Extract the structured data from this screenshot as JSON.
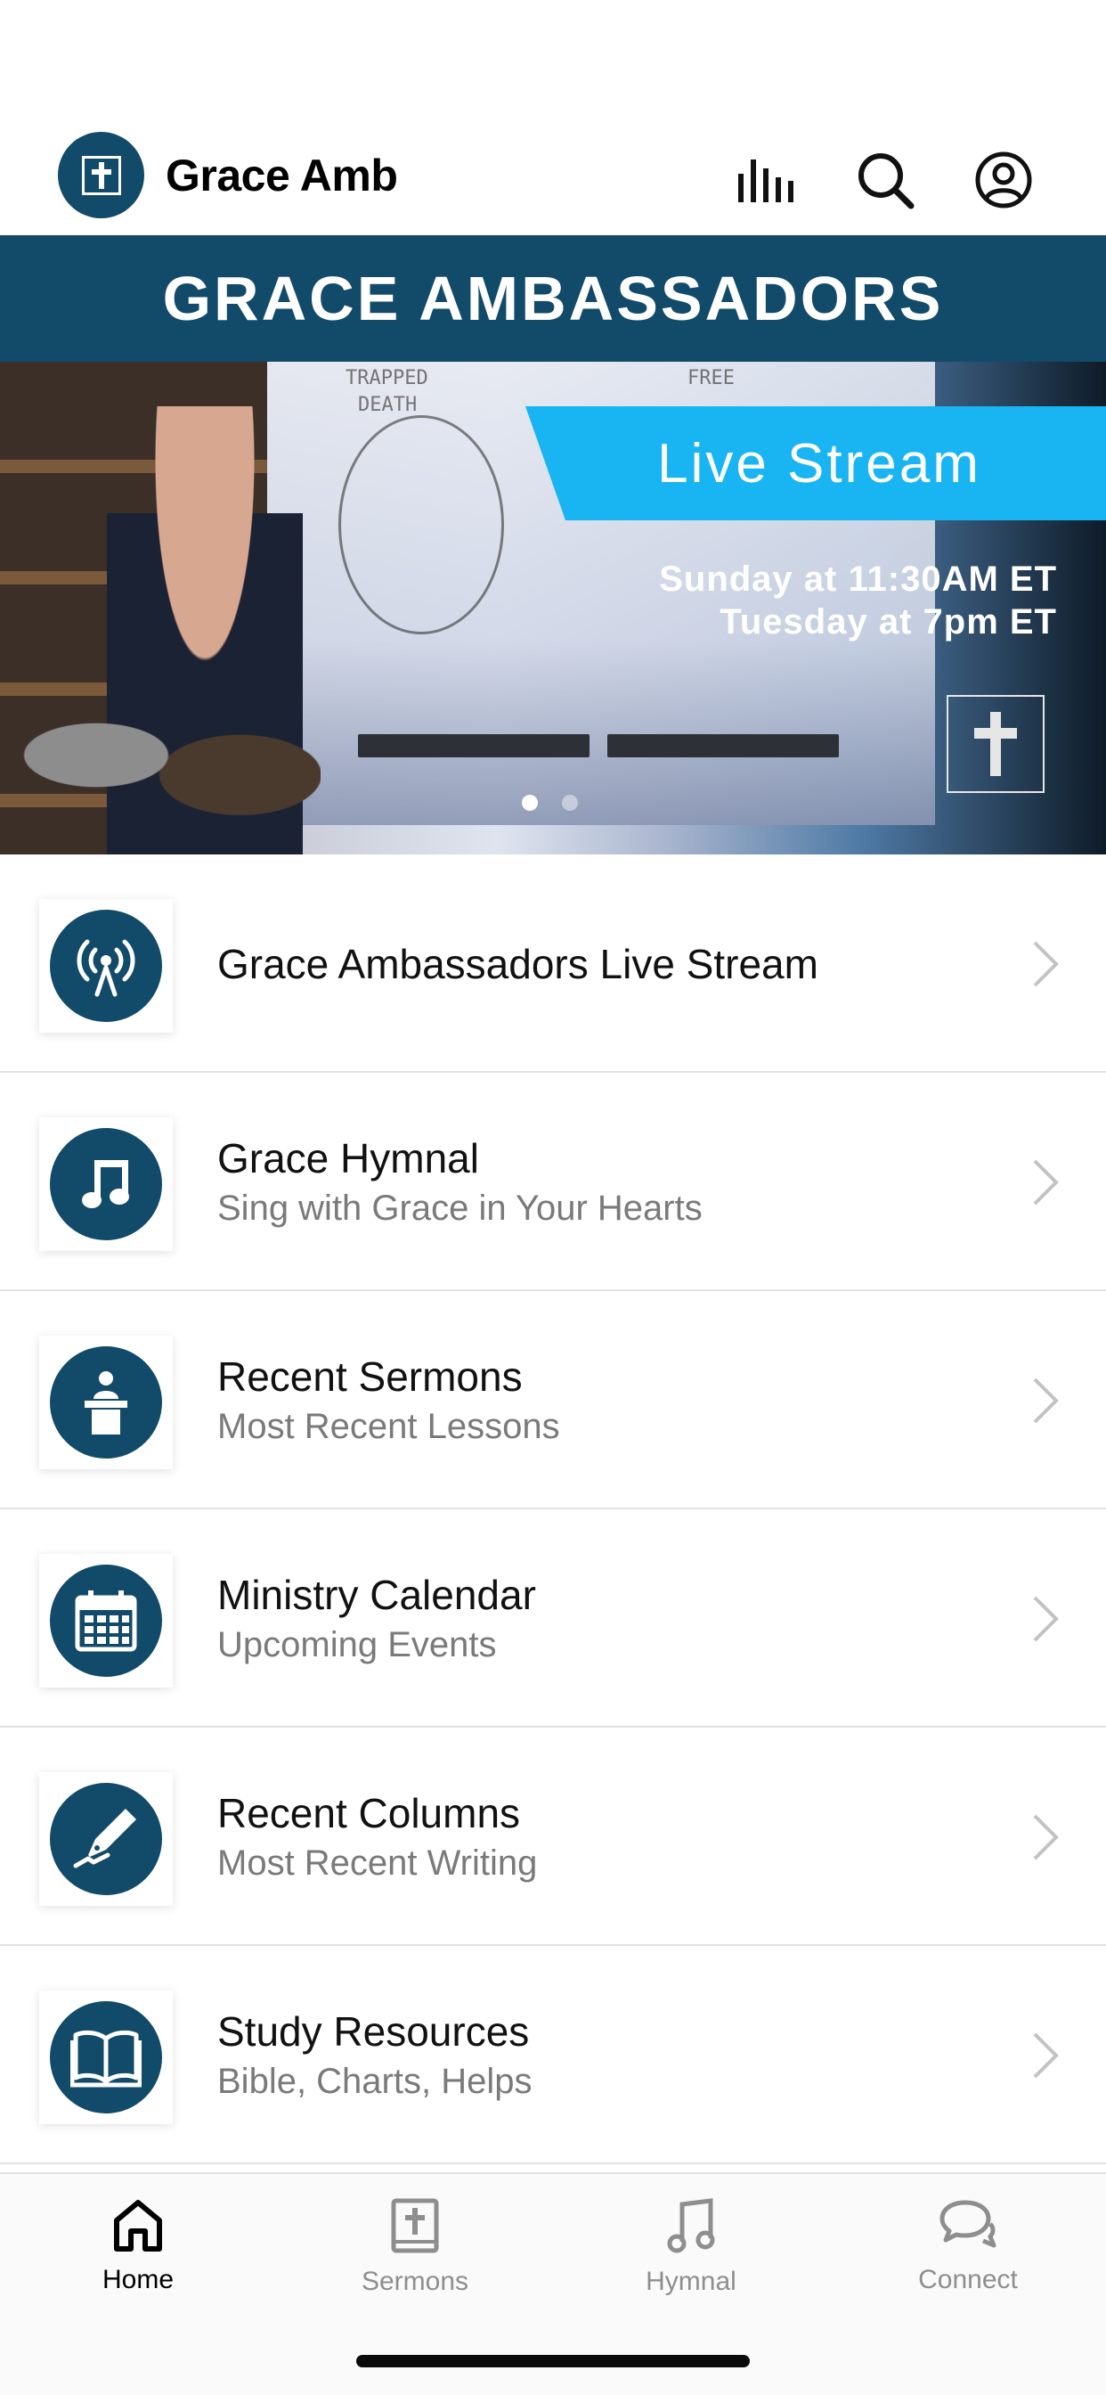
{
  "app": {
    "title": "Grace Amb"
  },
  "header": {
    "banner_text": "GRACE AMBASSADORS",
    "icons": [
      "audio-bars-icon",
      "search-icon",
      "profile-icon"
    ]
  },
  "hero": {
    "live_label": "Live Stream",
    "schedule_line1": "Sunday at 11:30AM ET",
    "schedule_line2": "Tuesday at 7pm ET",
    "whiteboard_text_1": "TRAPPED",
    "whiteboard_text_2": "DEATH",
    "whiteboard_text_3": "FREE",
    "slide_count": 2,
    "active_slide": 1
  },
  "list": {
    "items": [
      {
        "title": "Grace Ambassadors Live Stream",
        "subtitle": "",
        "icon": "broadcast-icon"
      },
      {
        "title": "Grace Hymnal",
        "subtitle": "Sing with Grace in Your Hearts",
        "icon": "music-note-icon"
      },
      {
        "title": "Recent Sermons",
        "subtitle": "Most Recent Lessons",
        "icon": "podium-speaker-icon"
      },
      {
        "title": "Ministry Calendar",
        "subtitle": "Upcoming Events",
        "icon": "calendar-icon"
      },
      {
        "title": "Recent Columns",
        "subtitle": "Most Recent Writing",
        "icon": "pen-nib-icon"
      },
      {
        "title": "Study Resources",
        "subtitle": "Bible, Charts, Helps",
        "icon": "open-book-icon"
      }
    ]
  },
  "tabs": [
    {
      "label": "Home",
      "icon": "home-icon",
      "active": true
    },
    {
      "label": "Sermons",
      "icon": "bible-icon",
      "active": false
    },
    {
      "label": "Hymnal",
      "icon": "music-note-icon",
      "active": false
    },
    {
      "label": "Connect",
      "icon": "chat-bubbles-icon",
      "active": false
    }
  ],
  "colors": {
    "brand": "#124a69",
    "live_banner": "#19b5f2",
    "inactive_tab": "#8e8e8e"
  }
}
